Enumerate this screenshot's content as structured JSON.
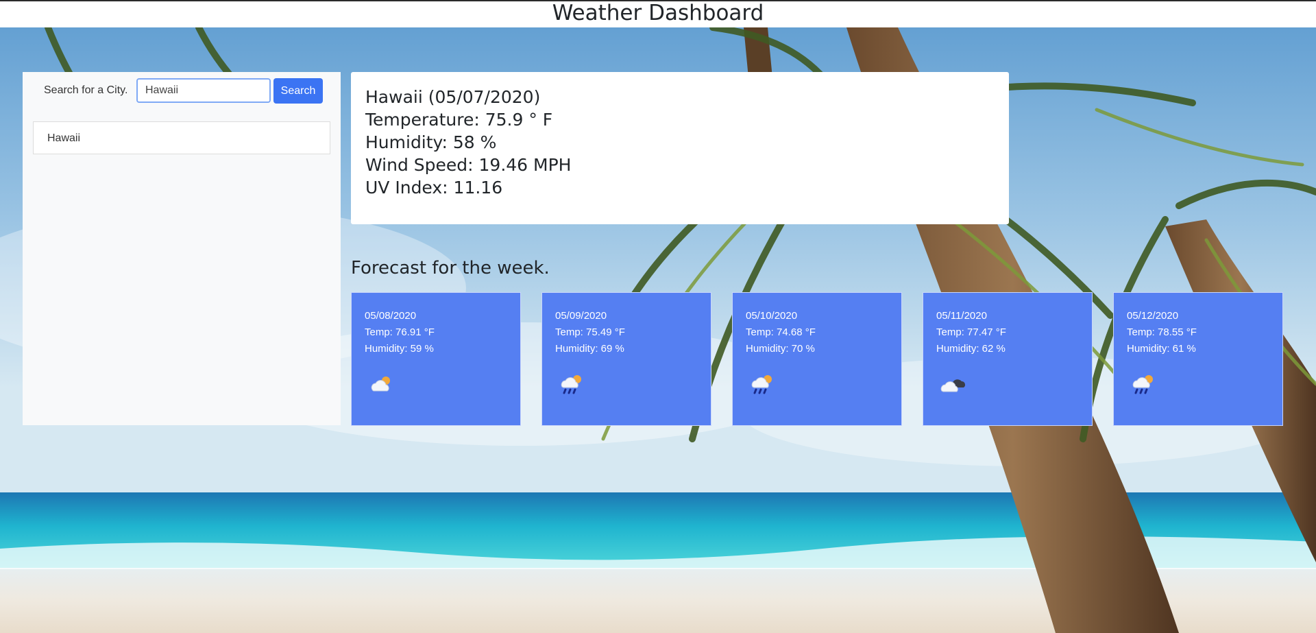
{
  "header": {
    "title": "Weather Dashboard"
  },
  "search": {
    "label": "Search for a City.",
    "value": "Hawaii",
    "button_label": "Search"
  },
  "history": [
    {
      "label": "Hawaii"
    }
  ],
  "current": {
    "title": "Hawaii (05/07/2020)",
    "temperature": "Temperature: 75.9 ° F",
    "humidity": "Humidity: 58 %",
    "wind": "Wind Speed: 19.46 MPH",
    "uv": "UV Index: 11.16"
  },
  "forecast": {
    "heading": "Forecast for the week.",
    "days": [
      {
        "date": "05/08/2020",
        "temp": "Temp: 76.91 °F",
        "humidity": "Humidity: 59 %",
        "icon": "partly-sunny-icon"
      },
      {
        "date": "05/09/2020",
        "temp": "Temp: 75.49 °F",
        "humidity": "Humidity: 69 %",
        "icon": "sun-rain-icon"
      },
      {
        "date": "05/10/2020",
        "temp": "Temp: 74.68 °F",
        "humidity": "Humidity: 70 %",
        "icon": "sun-rain-icon"
      },
      {
        "date": "05/11/2020",
        "temp": "Temp: 77.47 °F",
        "humidity": "Humidity: 62 %",
        "icon": "cloudy-night-icon"
      },
      {
        "date": "05/12/2020",
        "temp": "Temp: 78.55 °F",
        "humidity": "Humidity: 61 %",
        "icon": "sun-rain-icon"
      }
    ]
  },
  "colors": {
    "search_button": "#3b74f3",
    "forecast_card": "#557ff2"
  }
}
